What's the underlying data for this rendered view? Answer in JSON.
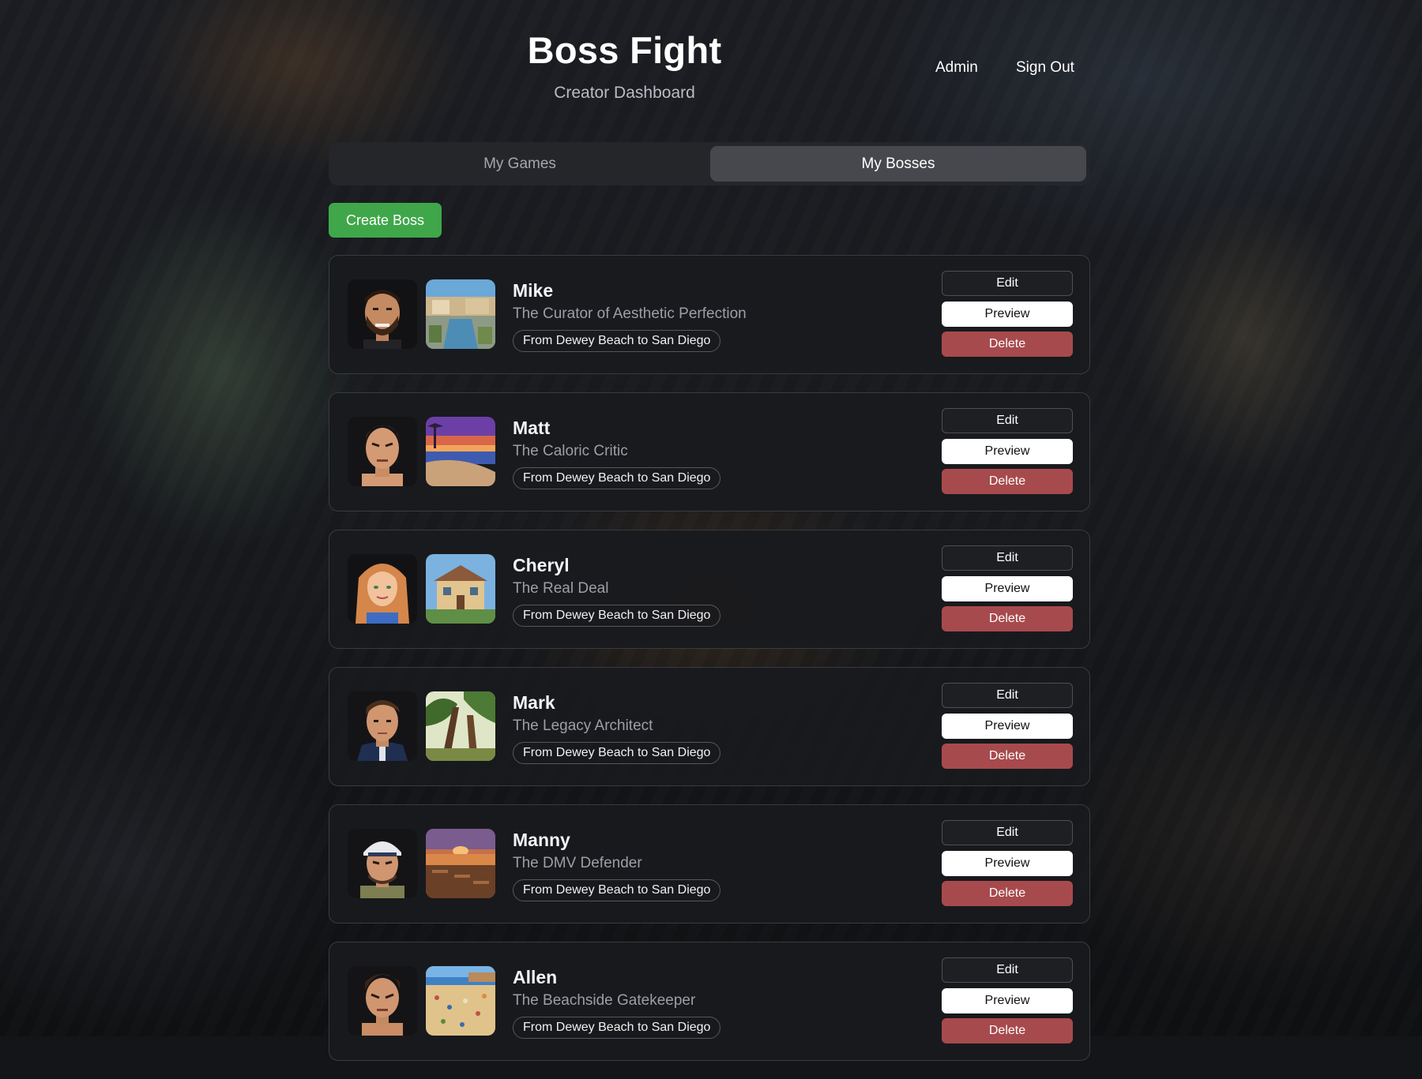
{
  "header": {
    "title": "Boss Fight",
    "subtitle": "Creator Dashboard",
    "nav": {
      "admin": "Admin",
      "sign_out": "Sign Out"
    }
  },
  "tabs": [
    {
      "label": "My Games",
      "active": false
    },
    {
      "label": "My Bosses",
      "active": true
    }
  ],
  "create_button": "Create Boss",
  "colors": {
    "accent_green": "#3fa74a",
    "delete_red": "#a74a4d",
    "card_bg": "#191a1d",
    "active_tab_bg": "#47484e"
  },
  "bosses": [
    {
      "name": "Mike",
      "title": "The Curator of Aesthetic Perfection",
      "route": "From Dewey Beach to San Diego",
      "portrait_icon": "bearded-man-portrait",
      "scene_icon": "coastal-villa-scene",
      "actions": {
        "edit": "Edit",
        "preview": "Preview",
        "delete": "Delete"
      }
    },
    {
      "name": "Matt",
      "title": "The Caloric Critic",
      "route": "From Dewey Beach to San Diego",
      "portrait_icon": "angry-man-portrait",
      "scene_icon": "sunset-beach-scene",
      "actions": {
        "edit": "Edit",
        "preview": "Preview",
        "delete": "Delete"
      }
    },
    {
      "name": "Cheryl",
      "title": "The Real Deal",
      "route": "From Dewey Beach to San Diego",
      "portrait_icon": "blonde-woman-portrait",
      "scene_icon": "suburban-house-scene",
      "actions": {
        "edit": "Edit",
        "preview": "Preview",
        "delete": "Delete"
      }
    },
    {
      "name": "Mark",
      "title": "The Legacy Architect",
      "route": "From Dewey Beach to San Diego",
      "portrait_icon": "man-in-jacket-portrait",
      "scene_icon": "forest-trees-scene",
      "actions": {
        "edit": "Edit",
        "preview": "Preview",
        "delete": "Delete"
      }
    },
    {
      "name": "Manny",
      "title": "The DMV Defender",
      "route": "From Dewey Beach to San Diego",
      "portrait_icon": "man-in-cap-portrait",
      "scene_icon": "seaside-deck-scene",
      "actions": {
        "edit": "Edit",
        "preview": "Preview",
        "delete": "Delete"
      }
    },
    {
      "name": "Allen",
      "title": "The Beachside Gatekeeper",
      "route": "From Dewey Beach to San Diego",
      "portrait_icon": "stern-man-portrait",
      "scene_icon": "crowded-beach-scene",
      "actions": {
        "edit": "Edit",
        "preview": "Preview",
        "delete": "Delete"
      }
    }
  ]
}
